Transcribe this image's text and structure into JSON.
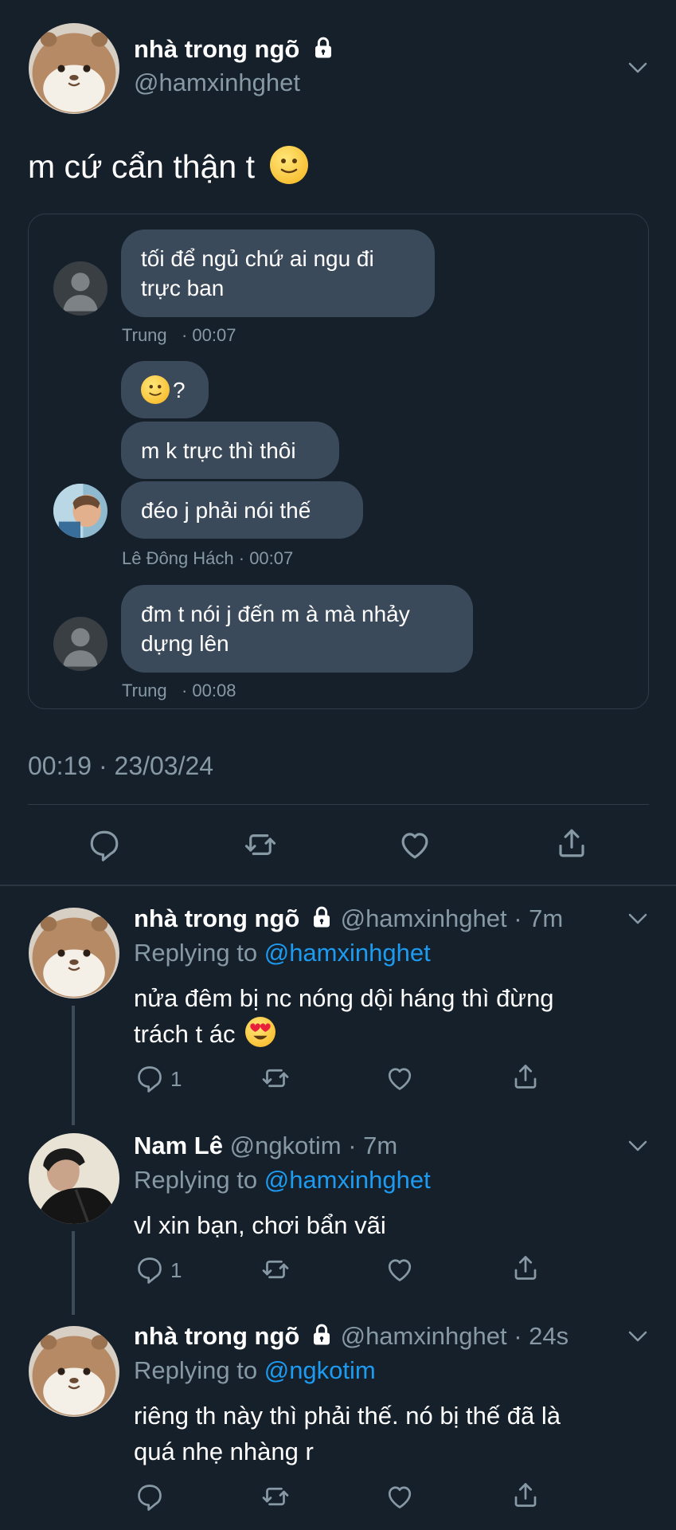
{
  "tweet": {
    "display_name": "nhà trong ngõ",
    "handle": "@hamxinhghet",
    "text": "m cứ cẩn thận t",
    "timestamp": "00:19 · 23/03/24",
    "icons": [
      "lock-icon",
      "chevron-down-icon",
      "reply-icon",
      "retweet-icon",
      "like-icon",
      "share-icon"
    ]
  },
  "chat": {
    "groups": [
      {
        "messages": [
          "tối để ngủ chứ ai ngu đi trực ban"
        ],
        "caption": "Trung   · 00:07"
      },
      {
        "messages": [
          "?",
          "m k trực thì thôi",
          "đéo j phải nói thế"
        ],
        "caption": "Lê Đông Hách · 00:07"
      },
      {
        "messages": [
          "đm t nói j đến m à mà nhảy dựng lên"
        ],
        "caption": "Trung   · 00:08"
      }
    ],
    "line1a": "tối để ngủ chứ ai ngu đi",
    "line1b": "trực ban",
    "q": "?",
    "line3": "m k trực thì thôi",
    "line4": "đéo j phải nói thế",
    "line5a": "đm t nói j đến m à mà nhảy",
    "line5b": "dựng lên"
  },
  "replies": [
    {
      "name": "nhà trong ngõ",
      "handle": "@hamxinhghet",
      "time": "· 7m",
      "replying_prefix": "Replying to",
      "replying_to": "@hamxinhghet",
      "text_line1": "nửa đêm bị nc nóng dội háng thì đừng",
      "text_line2": "trách t ác",
      "reply_count": "1"
    },
    {
      "name": "Nam Lê",
      "handle": "@ngkotim",
      "time": "· 7m",
      "replying_prefix": "Replying to",
      "replying_to": "@hamxinhghet",
      "text_line1": "vl xin bạn, chơi bẩn vãi",
      "reply_count": "1"
    },
    {
      "name": "nhà trong ngõ",
      "handle": "@hamxinhghet",
      "time": "· 24s",
      "replying_prefix": "Replying to",
      "replying_to": "@ngkotim",
      "text_line1": "riêng th này thì phải thế. nó bị thế đã là",
      "text_line2": "quá nhẹ nhàng r"
    }
  ]
}
